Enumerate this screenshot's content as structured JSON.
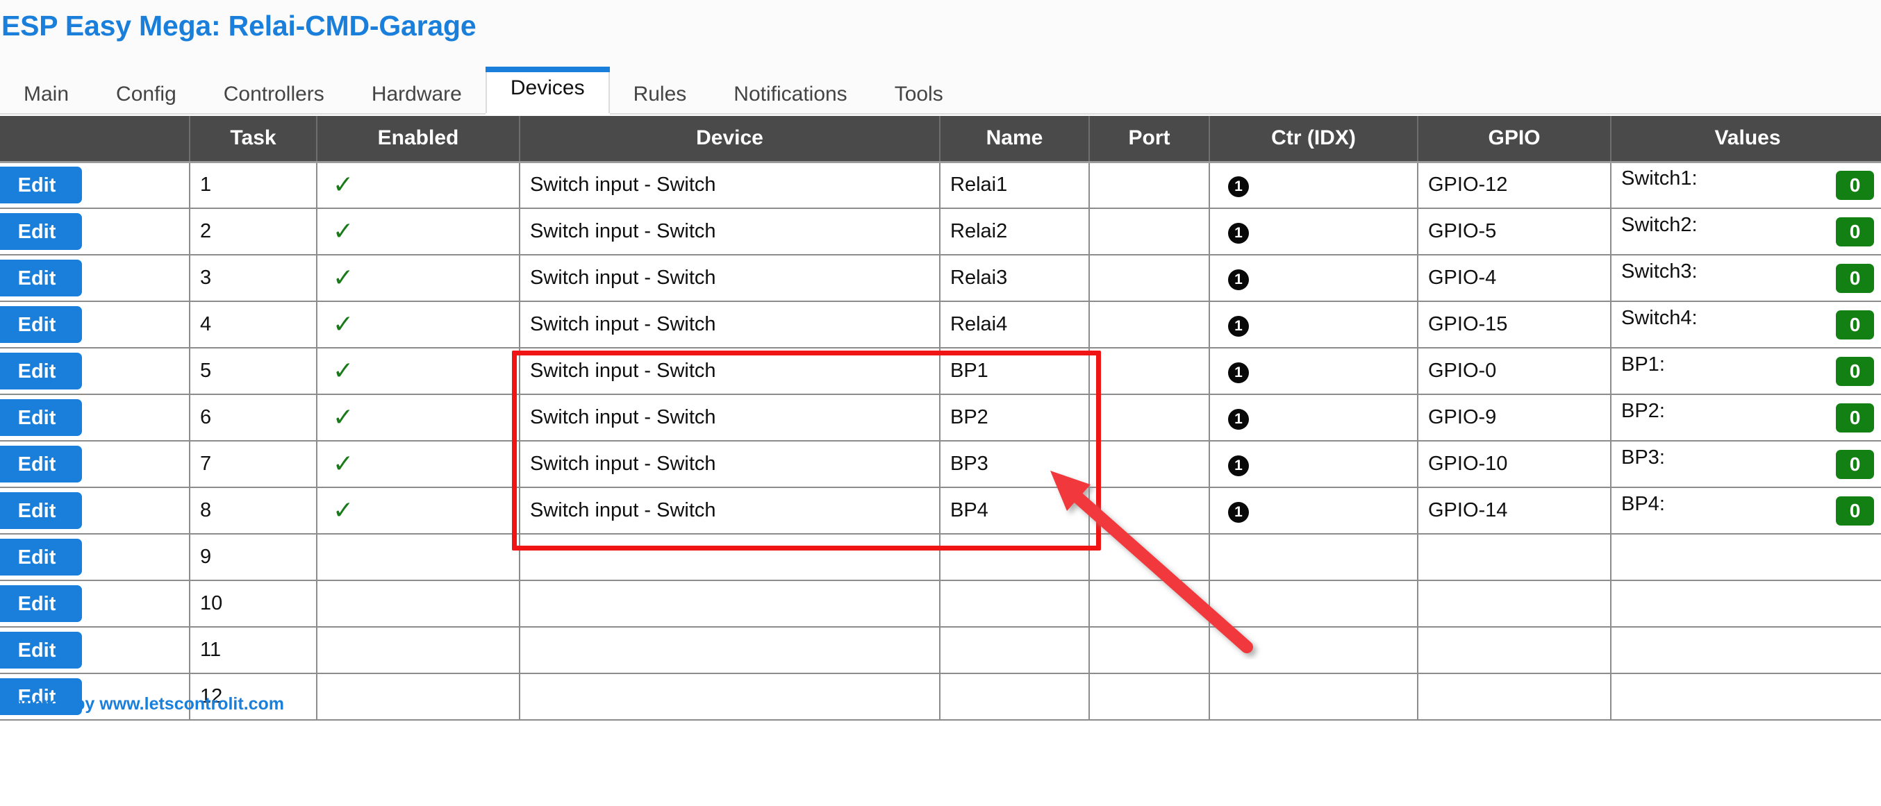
{
  "header": {
    "title": "ESP Easy Mega: Relai-CMD-Garage",
    "title_color": "#1a7fdb"
  },
  "tabs": [
    {
      "label": "Main",
      "active": false
    },
    {
      "label": "Config",
      "active": false
    },
    {
      "label": "Controllers",
      "active": false
    },
    {
      "label": "Hardware",
      "active": false
    },
    {
      "label": "Devices",
      "active": true
    },
    {
      "label": "Rules",
      "active": false
    },
    {
      "label": "Notifications",
      "active": false
    },
    {
      "label": "Tools",
      "active": false
    }
  ],
  "table": {
    "columns": [
      "",
      "Task",
      "Enabled",
      "Device",
      "Name",
      "Port",
      "Ctr (IDX)",
      "GPIO",
      "Values"
    ],
    "edit_label": "Edit",
    "enabled_glyph": "✓",
    "ctr_badge_text": "1",
    "rows": [
      {
        "task": "1",
        "enabled": true,
        "device": "Switch input - Switch",
        "name": "Relai1",
        "port": "",
        "ctr": "1",
        "gpio": "GPIO-12",
        "value_label": "Switch1:",
        "value": "0"
      },
      {
        "task": "2",
        "enabled": true,
        "device": "Switch input - Switch",
        "name": "Relai2",
        "port": "",
        "ctr": "1",
        "gpio": "GPIO-5",
        "value_label": "Switch2:",
        "value": "0"
      },
      {
        "task": "3",
        "enabled": true,
        "device": "Switch input - Switch",
        "name": "Relai3",
        "port": "",
        "ctr": "1",
        "gpio": "GPIO-4",
        "value_label": "Switch3:",
        "value": "0"
      },
      {
        "task": "4",
        "enabled": true,
        "device": "Switch input - Switch",
        "name": "Relai4",
        "port": "",
        "ctr": "1",
        "gpio": "GPIO-15",
        "value_label": "Switch4:",
        "value": "0"
      },
      {
        "task": "5",
        "enabled": true,
        "device": "Switch input - Switch",
        "name": "BP1",
        "port": "",
        "ctr": "1",
        "gpio": "GPIO-0",
        "value_label": "BP1:",
        "value": "0"
      },
      {
        "task": "6",
        "enabled": true,
        "device": "Switch input - Switch",
        "name": "BP2",
        "port": "",
        "ctr": "1",
        "gpio": "GPIO-9",
        "value_label": "BP2:",
        "value": "0"
      },
      {
        "task": "7",
        "enabled": true,
        "device": "Switch input - Switch",
        "name": "BP3",
        "port": "",
        "ctr": "1",
        "gpio": "GPIO-10",
        "value_label": "BP3:",
        "value": "0"
      },
      {
        "task": "8",
        "enabled": true,
        "device": "Switch input - Switch",
        "name": "BP4",
        "port": "",
        "ctr": "1",
        "gpio": "GPIO-14",
        "value_label": "BP4:",
        "value": "0"
      },
      {
        "task": "9",
        "enabled": false,
        "device": "",
        "name": "",
        "port": "",
        "ctr": "",
        "gpio": "",
        "value_label": "",
        "value": ""
      },
      {
        "task": "10",
        "enabled": false,
        "device": "",
        "name": "",
        "port": "",
        "ctr": "",
        "gpio": "",
        "value_label": "",
        "value": ""
      },
      {
        "task": "11",
        "enabled": false,
        "device": "",
        "name": "",
        "port": "",
        "ctr": "",
        "gpio": "",
        "value_label": "",
        "value": ""
      },
      {
        "task": "12",
        "enabled": false,
        "device": "",
        "name": "",
        "port": "",
        "ctr": "",
        "gpio": "",
        "value_label": "",
        "value": ""
      }
    ]
  },
  "footer": {
    "text": "Powered by www.letscontrolit.com"
  },
  "annotations": {
    "highlight_color": "#f01414",
    "arrow_color": "#f0383c"
  }
}
